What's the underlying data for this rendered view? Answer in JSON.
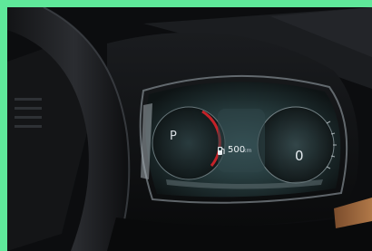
{
  "cluster": {
    "gear": "P",
    "range_value": "500",
    "range_unit": "km",
    "speed_value": "0"
  },
  "colors": {
    "frame_border": "#5fe89a",
    "dash": "#0b0c0e",
    "accent_red": "#d8232a",
    "display_teal": "#2e5e63"
  }
}
